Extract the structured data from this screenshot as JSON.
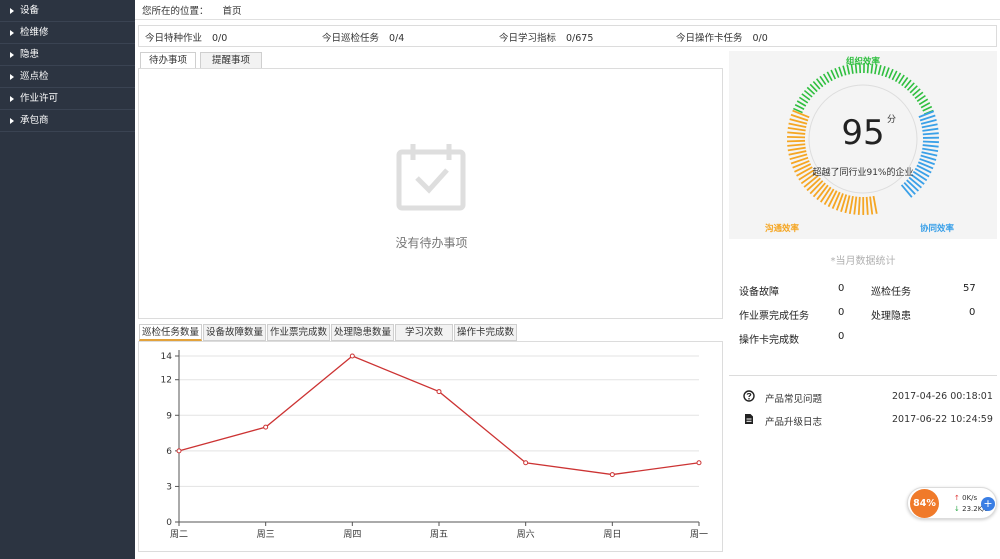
{
  "sidebar": {
    "items": [
      {
        "label": "设备"
      },
      {
        "label": "检维修"
      },
      {
        "label": "隐患"
      },
      {
        "label": "巡点检"
      },
      {
        "label": "作业许可"
      },
      {
        "label": "承包商"
      }
    ]
  },
  "breadcrumb": {
    "prefix": "您所在的位置：",
    "current": "首页"
  },
  "stats": [
    {
      "label": "今日特种作业",
      "value": "0/0"
    },
    {
      "label": "今日巡检任务",
      "value": "0/4"
    },
    {
      "label": "今日学习指标",
      "value": "0/675"
    },
    {
      "label": "今日操作卡任务",
      "value": "0/0"
    }
  ],
  "top_tabs": [
    {
      "label": "待办事项"
    },
    {
      "label": "提醒事项"
    }
  ],
  "empty_state": {
    "text": "没有待办事项",
    "icon": "calendar-check-icon"
  },
  "chart_tabs": [
    {
      "label": "巡检任务数量"
    },
    {
      "label": "设备故障数量"
    },
    {
      "label": "作业票完成数"
    },
    {
      "label": "处理隐患数量"
    },
    {
      "label": "学习次数"
    },
    {
      "label": "操作卡完成数"
    }
  ],
  "chart_data": {
    "type": "line",
    "categories": [
      "周二",
      "周三",
      "周四",
      "周五",
      "周六",
      "周日",
      "周一"
    ],
    "series": [
      {
        "values": [
          6,
          8,
          14,
          11,
          5,
          4,
          5
        ]
      }
    ],
    "yticks": [
      0,
      3,
      6,
      9,
      12,
      14
    ],
    "ylim": [
      0,
      14
    ],
    "grid": true,
    "color": "#cc3333"
  },
  "gauge": {
    "score": "95",
    "unit": "分",
    "description": "超越了同行业91%的企业",
    "labels": {
      "top": "组织效率",
      "left": "沟通效率",
      "right": "协同效率"
    },
    "colors": {
      "top": "#2fbf3f",
      "left": "#f5a623",
      "right": "#3aa0e8"
    }
  },
  "monthly": {
    "title": "*当月数据统计",
    "items": [
      {
        "label": "设备故障",
        "value": "0"
      },
      {
        "label": "巡检任务",
        "value": "57"
      },
      {
        "label": "作业票完成任务",
        "value": "0"
      },
      {
        "label": "处理隐患",
        "value": "0"
      },
      {
        "label": "操作卡完成数",
        "value": "0"
      }
    ]
  },
  "links": [
    {
      "label": "产品常见问题",
      "time": "2017-04-26 00:18:01",
      "icon": "question-circle-icon"
    },
    {
      "label": "产品升级日志",
      "time": "2017-06-22 10:24:59",
      "icon": "document-icon"
    }
  ],
  "float_widget": {
    "percent": "84%",
    "up": "0K/s",
    "down": "23.2K/s",
    "plus": "+"
  }
}
